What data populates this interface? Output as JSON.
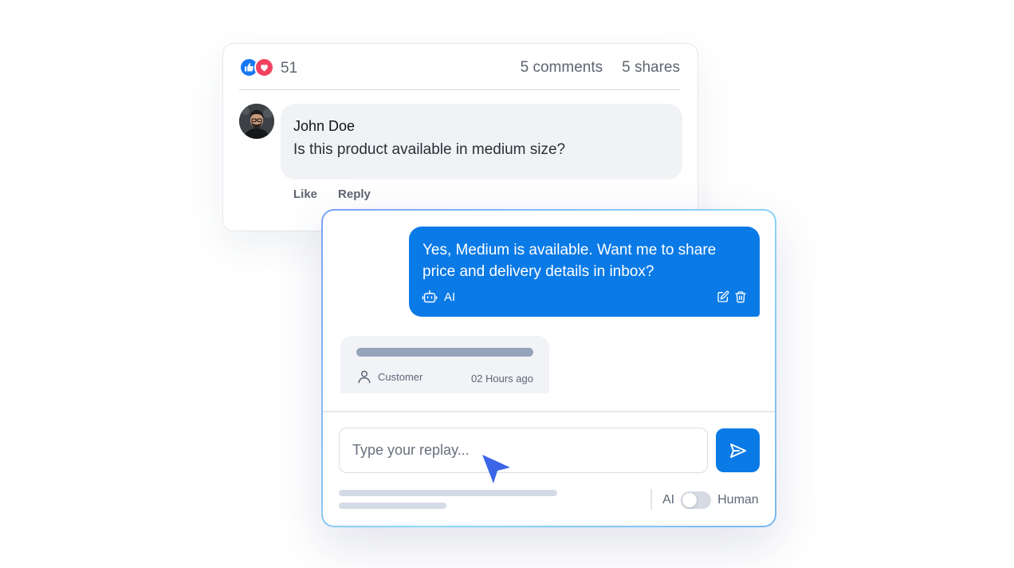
{
  "post": {
    "reaction_count": "51",
    "comments": "5 comments",
    "shares": "5 shares",
    "comment": {
      "author": "John Doe",
      "text": "Is this product available in medium size?"
    },
    "actions": {
      "like": "Like",
      "reply": "Reply"
    }
  },
  "reply_panel": {
    "ai_message": {
      "text": "Yes, Medium is available. Want me to share price and delivery details in inbox?",
      "tag": "AI"
    },
    "customer_message": {
      "sender": "Customer",
      "time": "02 Hours ago"
    },
    "input": {
      "placeholder": "Type your replay..."
    },
    "mode": {
      "left": "AI",
      "right": "Human"
    }
  },
  "colors": {
    "primary": "#0a7ae6",
    "like": "#1877f2",
    "love": "#f3425f",
    "cursor": "#3b66e8"
  }
}
